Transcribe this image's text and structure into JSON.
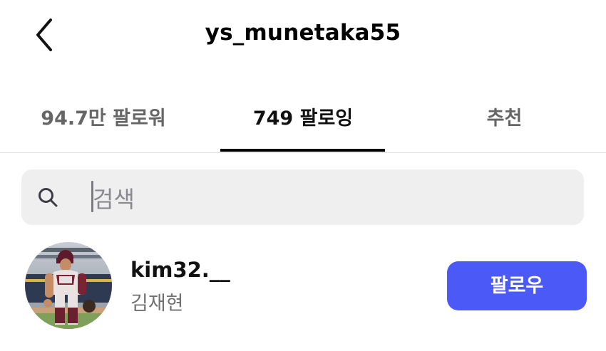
{
  "header": {
    "title": "ys_munetaka55",
    "back_icon": "chevron-left-icon"
  },
  "tabs": {
    "followers": "94.7만 팔로워",
    "following": "749 팔로잉",
    "suggested": "추천",
    "active": "following"
  },
  "search": {
    "placeholder": "검색",
    "icon": "search-icon"
  },
  "users": [
    {
      "username": "kim32.__",
      "full_name": "김재현",
      "follow_label": "팔로우"
    }
  ],
  "colors": {
    "accent": "#4b59f6",
    "search_bg": "#efeff0",
    "secondary_text": "#707070"
  }
}
